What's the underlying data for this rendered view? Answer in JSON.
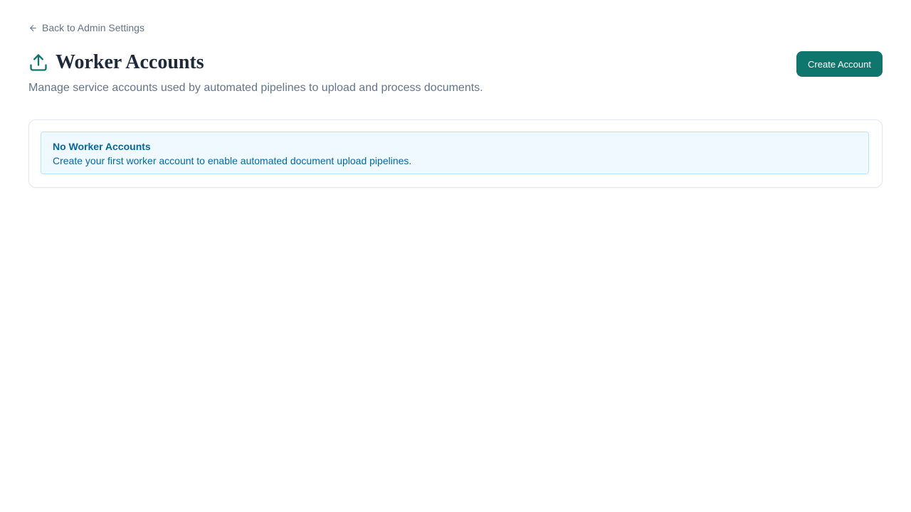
{
  "nav": {
    "back_label": "Back to Admin Settings",
    "back_icon": "arrow-left-icon"
  },
  "header": {
    "icon": "upload-icon",
    "title": "Worker Accounts",
    "subtitle": "Manage service accounts used by automated pipelines to upload and process documents.",
    "create_button_label": "Create Account"
  },
  "empty_state": {
    "title": "No Worker Accounts",
    "message": "Create your first worker account to enable automated document upload pipelines."
  },
  "colors": {
    "accent": "#0f766e",
    "title": "#1e293b",
    "muted": "#64748b",
    "alert_bg": "#f0f9ff",
    "alert_border": "#bae6fd",
    "alert_text": "#0369a1"
  }
}
